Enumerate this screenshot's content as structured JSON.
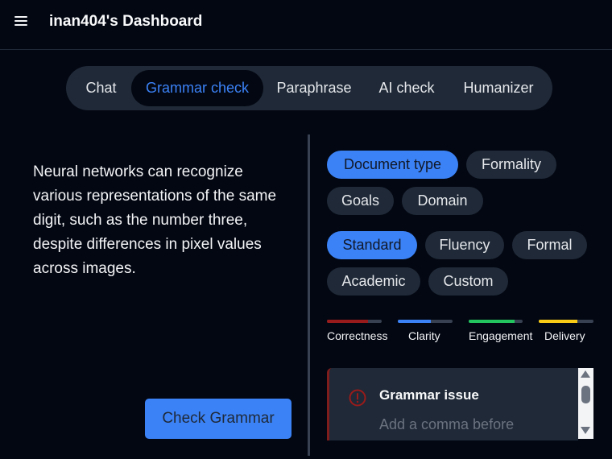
{
  "header": {
    "title": "inan404's Dashboard",
    "menu_icon": "hamburger-menu-icon"
  },
  "tabs": [
    {
      "label": "Chat",
      "active": false
    },
    {
      "label": "Grammar check",
      "active": true
    },
    {
      "label": "Paraphrase",
      "active": false
    },
    {
      "label": "AI check",
      "active": false
    },
    {
      "label": "Humanizer",
      "active": false
    }
  ],
  "editor": {
    "text": "Neural networks can recognize various representations of the same digit, such as the number three, despite differences in pixel values across images.",
    "button_label": "Check Grammar"
  },
  "settings": {
    "categories": [
      {
        "label": "Document type",
        "active": true
      },
      {
        "label": "Formality",
        "active": false
      },
      {
        "label": "Goals",
        "active": false
      },
      {
        "label": "Domain",
        "active": false
      }
    ],
    "options": [
      {
        "label": "Standard",
        "active": true
      },
      {
        "label": "Fluency",
        "active": false
      },
      {
        "label": "Formal",
        "active": false
      },
      {
        "label": "Academic",
        "active": false
      },
      {
        "label": "Custom",
        "active": false
      }
    ]
  },
  "scores": [
    {
      "label": "Correctness",
      "fraction": 0.75,
      "color": "#991b1b"
    },
    {
      "label": "Clarity",
      "fraction": 0.6,
      "color": "#3b82f6"
    },
    {
      "label": "Engagement",
      "fraction": 0.85,
      "color": "#22c55e"
    },
    {
      "label": "Delivery",
      "fraction": 0.7,
      "color": "#facc15"
    }
  ],
  "issue": {
    "icon": "alert-circle-icon",
    "title": "Grammar issue",
    "description": "Add a comma before"
  },
  "colors": {
    "accent": "#3b82f6",
    "background": "#030712",
    "surface": "#1f2937"
  }
}
